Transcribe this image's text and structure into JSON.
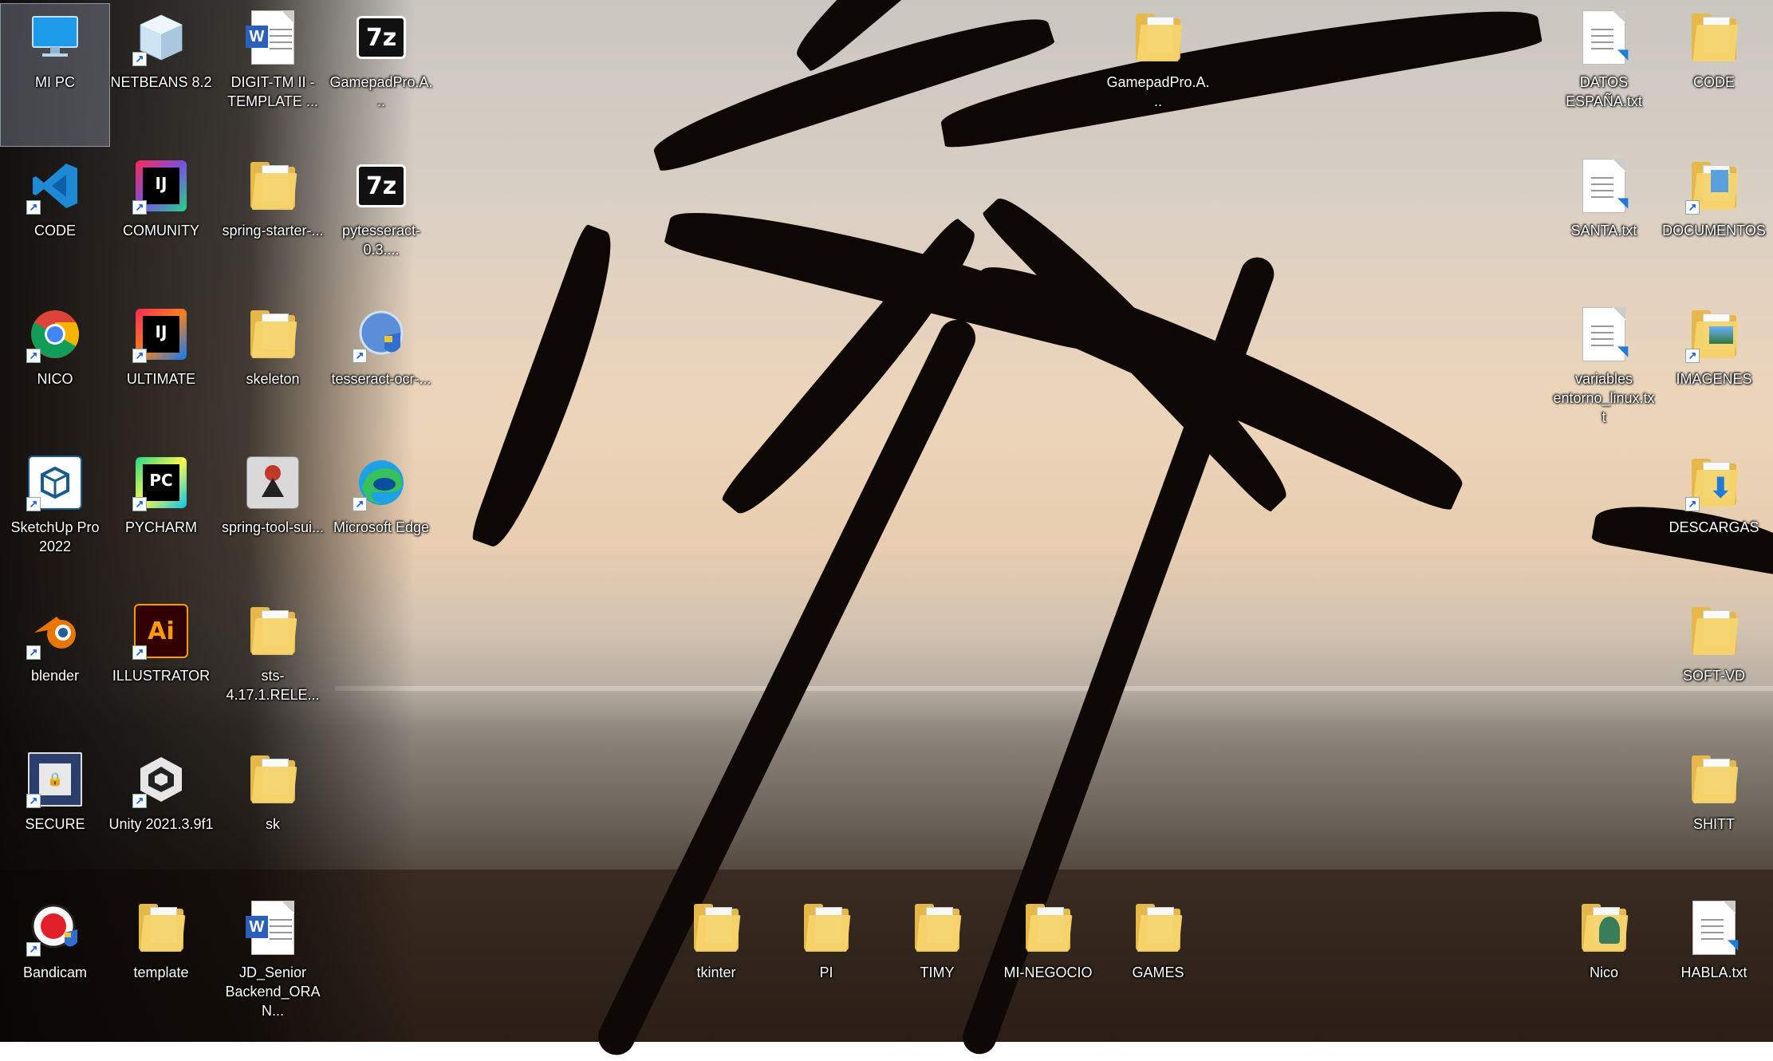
{
  "desktop": {
    "icons": [
      {
        "label": "MI PC",
        "icon": "computer-icon",
        "selected": true
      },
      {
        "label": "NETBEANS 8.2",
        "icon": "netbeans-cube-icon"
      },
      {
        "label": "DIGIT-TM II - TEMPLATE ...",
        "icon": "word-document-icon"
      },
      {
        "label": "GamepadPro.A...",
        "icon": "7zip-archive-icon"
      },
      {
        "label": "GamepadPro.A...",
        "icon": "folder-icon"
      },
      {
        "label": "DATOS ESPAÑA.txt",
        "icon": "text-document-icon"
      },
      {
        "label": "CODE",
        "icon": "folder-icon"
      },
      {
        "label": "CODE",
        "icon": "vscode-icon"
      },
      {
        "label": "COMUNITY",
        "icon": "intellij-community-icon"
      },
      {
        "label": "spring-starter-...",
        "icon": "folder-icon"
      },
      {
        "label": "pytesseract-0.3....",
        "icon": "7zip-archive-icon"
      },
      {
        "label": "SANTA.txt",
        "icon": "text-document-icon"
      },
      {
        "label": "DOCUMENTOS",
        "icon": "documents-folder-icon"
      },
      {
        "label": "NICO",
        "icon": "chrome-icon"
      },
      {
        "label": "ULTIMATE",
        "icon": "intellij-ultimate-icon"
      },
      {
        "label": "skeleton",
        "icon": "folder-icon"
      },
      {
        "label": "tesseract-ocr-...",
        "icon": "installer-shield-icon"
      },
      {
        "label": "variables entorno_linux.txt",
        "icon": "text-document-icon"
      },
      {
        "label": "IMAGENES",
        "icon": "pictures-folder-icon"
      },
      {
        "label": "SketchUp Pro 2022",
        "icon": "sketchup-icon"
      },
      {
        "label": "PYCHARM",
        "icon": "pycharm-icon"
      },
      {
        "label": "spring-tool-sui...",
        "icon": "java-installer-icon"
      },
      {
        "label": "Microsoft Edge",
        "icon": "edge-icon"
      },
      {
        "label": "DESCARGAS",
        "icon": "downloads-folder-icon"
      },
      {
        "label": "blender",
        "icon": "blender-icon"
      },
      {
        "label": "ILLUSTRATOR",
        "icon": "illustrator-icon"
      },
      {
        "label": "sts-4.17.1.RELE...",
        "icon": "folder-icon"
      },
      {
        "label": "SOFT-VD",
        "icon": "folder-icon"
      },
      {
        "label": "SECURE",
        "icon": "secure-app-icon"
      },
      {
        "label": "Unity 2021.3.9f1",
        "icon": "unity-icon"
      },
      {
        "label": "sk",
        "icon": "folder-icon"
      },
      {
        "label": "SHITT",
        "icon": "folder-icon"
      },
      {
        "label": "Bandicam",
        "icon": "bandicam-icon"
      },
      {
        "label": "template",
        "icon": "folder-icon"
      },
      {
        "label": "JD_Senior Backend_ORAN...",
        "icon": "word-document-icon"
      },
      {
        "label": "tkinter",
        "icon": "folder-icon"
      },
      {
        "label": "PI",
        "icon": "folder-icon"
      },
      {
        "label": "TIMY",
        "icon": "folder-icon"
      },
      {
        "label": "MI-NEGOCIO",
        "icon": "folder-icon"
      },
      {
        "label": "GAMES",
        "icon": "folder-icon"
      },
      {
        "label": "Nico",
        "icon": "user-folder-icon"
      },
      {
        "label": "HABLA.txt",
        "icon": "text-document-icon"
      }
    ]
  },
  "colors": {
    "label_text": "#ffffff",
    "folder_yellow": "#e6b84a",
    "selection": "#a0aabe"
  }
}
